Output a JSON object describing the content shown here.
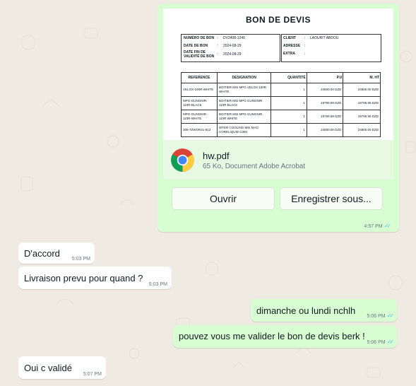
{
  "chat": {
    "pdf_message": {
      "document_title": "BON DE DEVIS",
      "header_left": [
        {
          "label": "NUMÉRO DE BON",
          "value": "DV2408-1240"
        },
        {
          "label": "DATE DE BON",
          "value": "2024-08-29"
        },
        {
          "label": "DATE FIN DE VALIDITÉ DE BON",
          "value": "2024-08-29"
        }
      ],
      "header_right": [
        {
          "label": "CLIENT",
          "value": "LAOURIT ABDOU"
        },
        {
          "label": "ADRESSE",
          "value": ""
        },
        {
          "label": "EXTRA",
          "value": ""
        }
      ],
      "table_headers": [
        "REFERENCE",
        "DESIGNATION",
        "QUANTITÉ",
        "P.U",
        "M. HT"
      ],
      "table_rows": [
        [
          "VELOX-100R-WHITE",
          "BOITIER MSI MPG VELOX 100R WHITE",
          "1",
          "24800.00 DZD",
          "24800.00 DZD"
        ],
        [
          "MPG-GUNGNIR-110R-BLACK",
          "BOITIER MSI MPG GUNGNIR 110R BLACK",
          "1",
          "19799.99 DZD",
          "19799.99 DZD"
        ],
        [
          "MPG-GUNGNIR-110R-WHITE",
          "BOITIER MSI MPG GUNGNIR 110R WHITE",
          "1",
          "19799.99 DZD",
          "19799.99 DZD"
        ],
        [
          "306-7ZWOR31-813",
          "WTER COOLING MSI MAG CORELIQUID C360",
          "1",
          "24800.00 DZD",
          "24800.00 DZD"
        ]
      ],
      "file_name": "hw.pdf",
      "file_meta": "65 Ko, Document Adobe Acrobat",
      "open_label": "Ouvrir",
      "save_label": "Enregistrer sous...",
      "time": "4:57 PM"
    },
    "messages": [
      {
        "text": "D'accord",
        "time": "5:03 PM",
        "direction": "in"
      },
      {
        "text": "Livraison prevu pour quand ?",
        "time": "5:03 PM",
        "direction": "in"
      },
      {
        "text": "dimanche ou lundi nchlh",
        "time": "5:06 PM",
        "direction": "out"
      },
      {
        "text": "pouvez vous me valider le bon de devis berk !",
        "time": "5:06 PM",
        "direction": "out"
      },
      {
        "text": "Oui c validé",
        "time": "5:07 PM",
        "direction": "in"
      }
    ]
  },
  "colors": {
    "background": "#efeae2",
    "incoming": "#ffffff",
    "outgoing": "#d9fdd3",
    "read_ticks": "#53bdeb"
  },
  "icons": [
    "chrome-icon",
    "double-check-icon"
  ]
}
